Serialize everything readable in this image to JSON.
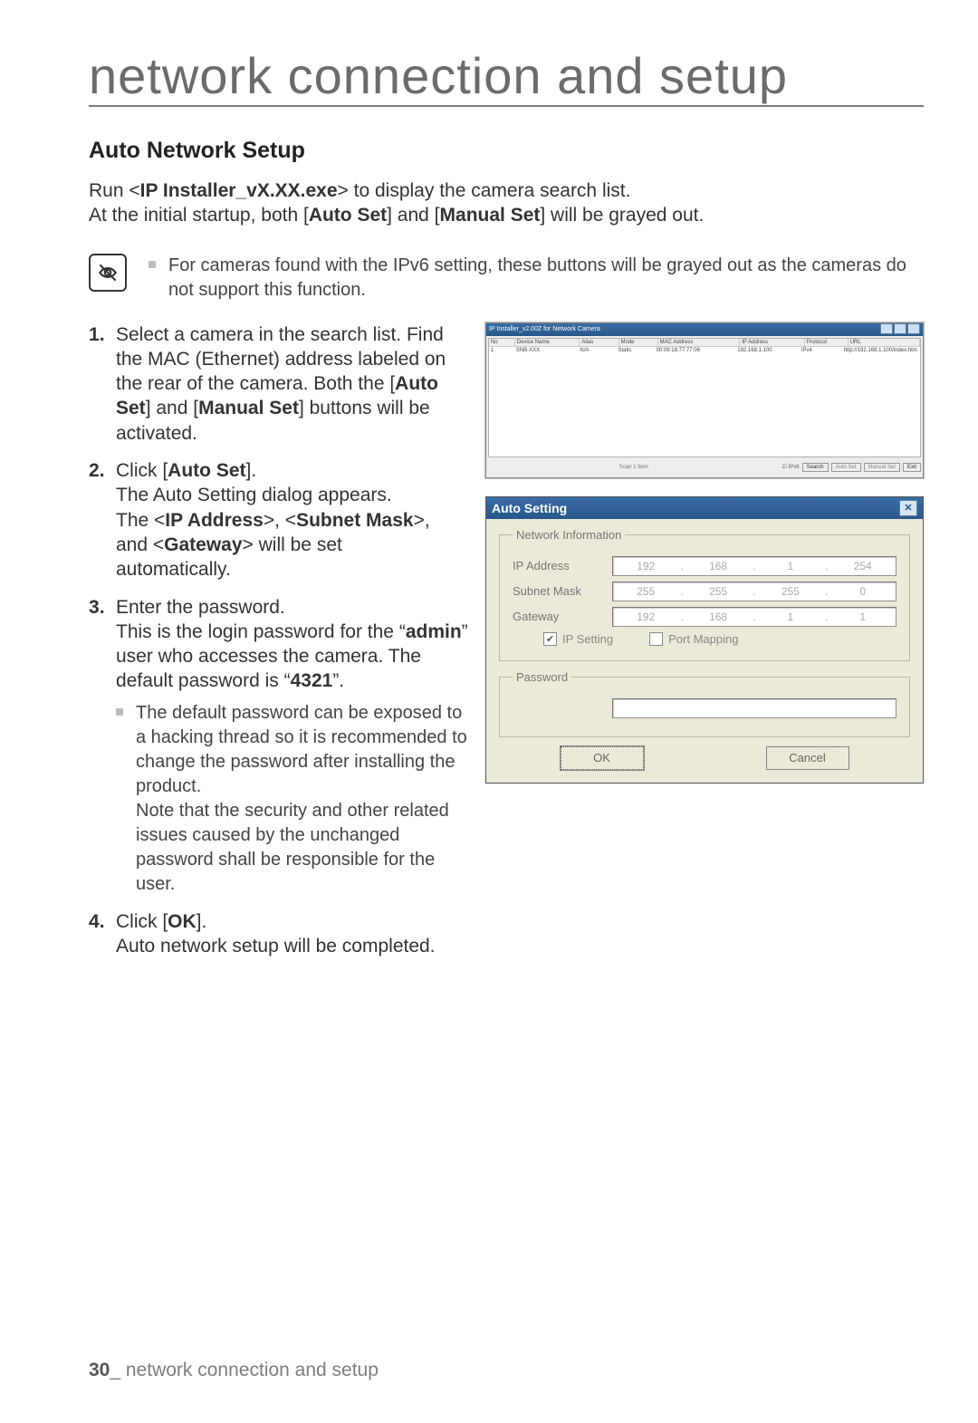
{
  "page_title": "network connection and setup",
  "section_heading": "Auto Network Setup",
  "intro": {
    "line1_pre": "Run <",
    "line1_bold": "IP Installer_vX.XX.exe",
    "line1_post": "> to display the camera search list.",
    "line2_pre": "At the initial startup, both [",
    "line2_b1": "Auto Set",
    "line2_mid": "] and [",
    "line2_b2": "Manual Set",
    "line2_post": "] will be grayed out."
  },
  "note1": "For cameras found with the IPv6 setting, these buttons will be grayed out as the cameras do not support this function.",
  "steps": {
    "s1": {
      "a": "Select a camera in the search list. Find the MAC (Ethernet) address labeled on the rear of the camera. Both the [",
      "b1": "Auto Set",
      "mid": "] and [",
      "b2": "Manual Set",
      "c": "] buttons will be activated."
    },
    "s2": {
      "pre": "Click [",
      "b": "Auto Set",
      "post": "].",
      "l2": "The Auto Setting dialog appears.",
      "l3_pre": "The <",
      "l3_b1": "IP Address",
      "l3_m1": ">, <",
      "l3_b2": "Subnet Mask",
      "l3_m2": ">, and <",
      "l3_b3": "Gateway",
      "l3_post": "> will be set automatically."
    },
    "s3": {
      "l1": "Enter the password.",
      "l2_pre": "This is the login password for the “",
      "l2_b": "admin",
      "l2_post": "” user who accesses the camera. The default password is “",
      "l2_b2": "4321",
      "l2_end": "”.",
      "sub": "The default password can be exposed to a hacking thread so it is recommended to change the password after installing the product.\nNote that the security and other related issues caused by the unchanged password shall be responsible for the user."
    },
    "s4": {
      "pre": "Click [",
      "b": "OK",
      "post": "].",
      "l2": "Auto network setup will be completed."
    }
  },
  "installer": {
    "title": "IP Installer_v2.00Z for Network Camera",
    "columns": [
      "No",
      "Device Name",
      "Alias",
      "Mode",
      "MAC Address",
      "IP Address",
      "Protocol",
      "URL"
    ],
    "row": [
      "1",
      "SNB-XXX",
      "N/A",
      "Static",
      "00:09:18:77:77:06",
      "192.168.1.100",
      "IPv4",
      "http://192.168.1.100/index.htm"
    ],
    "footer_label": "Scan 1 Item",
    "footer_ipv6": "IPv6",
    "buttons": [
      "Search",
      "Auto Set",
      "Manual Set",
      "Exit"
    ]
  },
  "dialog": {
    "title": "Auto Setting",
    "group1": "Network Information",
    "ip_label": "IP Address",
    "ip": [
      "192",
      "168",
      "1",
      "254"
    ],
    "mask_label": "Subnet Mask",
    "mask": [
      "255",
      "255",
      "255",
      "0"
    ],
    "gw_label": "Gateway",
    "gw": [
      "192",
      "168",
      "1",
      "1"
    ],
    "chk_ip": "IP Setting",
    "chk_port": "Port Mapping",
    "group2": "Password",
    "ok": "OK",
    "cancel": "Cancel"
  },
  "footer": {
    "page_num": "30",
    "sep": "_ ",
    "text": "network connection and setup"
  }
}
